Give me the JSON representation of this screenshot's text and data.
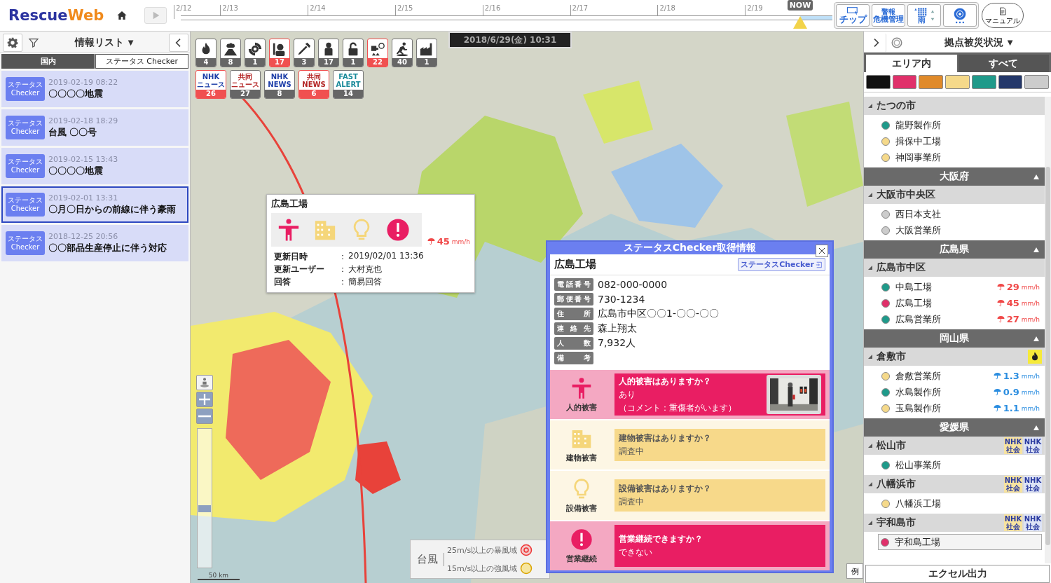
{
  "header": {
    "logo": {
      "main": "Rescue",
      "accent": "Web"
    },
    "timeline": {
      "dates": [
        "2/12",
        "2/13",
        "2/14",
        "2/15",
        "2/16",
        "2/17",
        "2/18",
        "2/19"
      ],
      "now_label": "NOW"
    },
    "tools": [
      {
        "kind": "chip",
        "label": "チップ"
      },
      {
        "kind": "alert",
        "title": "警報",
        "label": "危機管理"
      },
      {
        "kind": "rain",
        "label": "雨"
      },
      {
        "kind": "typhoon"
      },
      {
        "kind": "manual",
        "label": "マニュアル"
      }
    ]
  },
  "info_list": {
    "title": "情報リスト",
    "title_caret": "▼",
    "tabs": [
      {
        "label": "国内",
        "selected": false
      },
      {
        "label": "ステータス Checker",
        "selected": true
      }
    ],
    "items": [
      {
        "badge": [
          "ステータス",
          "Checker"
        ],
        "date": "2019-02-19 08:22",
        "title": "〇〇〇〇地震",
        "selected": false
      },
      {
        "badge": [
          "ステータス",
          "Checker"
        ],
        "date": "2019-02-18 18:29",
        "title": "台風 〇〇号",
        "selected": false
      },
      {
        "badge": [
          "ステータス",
          "Checker"
        ],
        "date": "2019-02-15 13:43",
        "title": "〇〇〇〇地震",
        "selected": false
      },
      {
        "badge": [
          "ステータス",
          "Checker"
        ],
        "date": "2019-02-01 13:31",
        "title": "〇月〇日からの前線に伴う豪雨",
        "selected": true
      },
      {
        "badge": [
          "ステータス",
          "Checker"
        ],
        "date": "2018-12-25 20:56",
        "title": "〇〇部品生産停止に伴う対応",
        "selected": false
      }
    ]
  },
  "map": {
    "date_box": "2018/6/29(金) 10:31",
    "categories": [
      {
        "kind": "fire",
        "count": "4",
        "alert": false
      },
      {
        "kind": "volcano",
        "count": "8",
        "alert": false
      },
      {
        "kind": "typhoon",
        "count": "1",
        "alert": false
      },
      {
        "kind": "worker",
        "count": "17",
        "alert": true
      },
      {
        "kind": "tool",
        "count": "3",
        "alert": false
      },
      {
        "kind": "person",
        "count": "17",
        "alert": false
      },
      {
        "kind": "lock",
        "count": "1",
        "alert": false
      },
      {
        "kind": "facility",
        "count": "22",
        "alert": true
      },
      {
        "kind": "runner",
        "count": "40",
        "alert": false
      },
      {
        "kind": "factory",
        "count": "1",
        "alert": false
      }
    ],
    "news": [
      {
        "lines": [
          "NHK",
          "ニュース"
        ],
        "color": "#1d3ea8",
        "count": "26",
        "alert": true
      },
      {
        "lines": [
          "共同",
          "ニュース"
        ],
        "color": "#b32424",
        "count": "27",
        "alert": false
      },
      {
        "lines": [
          "NHK",
          "NEWS"
        ],
        "color": "#1d3ea8",
        "count": "8",
        "alert": false
      },
      {
        "lines": [
          "共同",
          "NEWS"
        ],
        "color": "#b32424",
        "count": "6",
        "alert": true
      },
      {
        "lines": [
          "FAST",
          "ALERT"
        ],
        "color": "#1a8a9a",
        "count": "14",
        "alert": false
      }
    ],
    "zoom": {
      "level": 0.45
    },
    "scale": "50 km",
    "legend": {
      "title": "台風",
      "items": [
        {
          "kind": "storm",
          "label": "25m/s以上の暴風域"
        },
        {
          "kind": "strong",
          "label": "15m/s以上の強風域"
        }
      ]
    },
    "legend_button": "例",
    "popup": {
      "title": "広島工場",
      "statuses": [
        {
          "kind": "person",
          "severe": true
        },
        {
          "kind": "building",
          "severe": false
        },
        {
          "kind": "equipment",
          "severe": false
        },
        {
          "kind": "business",
          "severe": true
        }
      ],
      "rain": {
        "value": "45",
        "unit": "mm/h",
        "heavy": true
      },
      "separator": "：",
      "rows": [
        {
          "label": "更新日時",
          "value": "2019/02/01 13:36"
        },
        {
          "label": "更新ユーザー",
          "value": "大村克也"
        },
        {
          "label": "回答",
          "value": "簡易回答"
        }
      ]
    },
    "status_panel": {
      "title": "ステータスChecker取得情報",
      "site": "広島工場",
      "link": "ステータスChecker",
      "fields": [
        {
          "label": "電話番号",
          "value": "082-000-0000"
        },
        {
          "label": "郵便番号",
          "value": "730-1234"
        },
        {
          "label": "住所",
          "value": "広島市中区〇〇1-〇〇-〇〇"
        },
        {
          "label": "連絡先",
          "value": "森上翔太"
        },
        {
          "label": "人数",
          "value": "7,932人"
        },
        {
          "label": "備考"
        }
      ],
      "questions": [
        {
          "kind": "person",
          "severe": true,
          "category": "人的被害",
          "question": "人的被害はありますか？",
          "answer": "あり",
          "comment": "（コメント：重傷者がいます）"
        },
        {
          "kind": "building",
          "severe": false,
          "category": "建物被害",
          "question": "建物被害はありますか？",
          "answer": "調査中"
        },
        {
          "kind": "equipment",
          "severe": false,
          "category": "設備被害",
          "question": "設備被害はありますか？",
          "answer": "調査中"
        },
        {
          "kind": "business",
          "severe": true,
          "category": "営業継続",
          "question": "営業継続できますか？",
          "answer": "できない"
        }
      ]
    }
  },
  "site_panel": {
    "title": "拠点被災状況",
    "title_caret": "▼",
    "tabs": [
      {
        "label": "エリア内",
        "selected": true
      },
      {
        "label": "すべて",
        "selected": false
      }
    ],
    "filters": [
      {
        "color": "#111111"
      },
      {
        "color": "#e0306a"
      },
      {
        "color": "#e08a2a"
      },
      {
        "color": "#f5d98a"
      },
      {
        "color": "#1f9a8a"
      },
      {
        "color": "#24386a"
      },
      {
        "color": "#cccccc"
      }
    ],
    "tree": [
      {
        "kind": "city",
        "name": "たつの市",
        "expanded": true,
        "children": [
          {
            "name": "龍野製作所",
            "color": "#1f9a8a",
            "selected": false
          },
          {
            "name": "揖保中工場",
            "color": "#f5d98a",
            "selected": false
          },
          {
            "name": "神岡事業所",
            "color": "#f5d98a",
            "selected": false
          }
        ]
      },
      {
        "kind": "prefecture",
        "name": "大阪府",
        "expanded": true,
        "children": [
          {
            "kind": "city",
            "name": "大阪市中央区",
            "expanded": true,
            "children": [
              {
                "name": "西日本支社",
                "color": "#cccccc",
                "selected": false
              },
              {
                "name": "大阪営業所",
                "color": "#cccccc",
                "selected": false
              }
            ]
          }
        ]
      },
      {
        "kind": "prefecture",
        "name": "広島県",
        "expanded": true,
        "children": [
          {
            "kind": "city",
            "name": "広島市中区",
            "expanded": true,
            "children": [
              {
                "name": "中島工場",
                "color": "#1f9a8a",
                "selected": false,
                "rain": {
                  "value": "29",
                  "unit": "mm/h",
                  "heavy": true
                }
              },
              {
                "name": "広島工場",
                "color": "#e0306a",
                "selected": false,
                "rain": {
                  "value": "45",
                  "unit": "mm/h",
                  "heavy": true
                }
              },
              {
                "name": "広島営業所",
                "color": "#1f9a8a",
                "selected": false,
                "rain": {
                  "value": "27",
                  "unit": "mm/h",
                  "heavy": true
                }
              }
            ]
          }
        ]
      },
      {
        "kind": "prefecture",
        "name": "岡山県",
        "expanded": true,
        "children": [
          {
            "kind": "city",
            "name": "倉敷市",
            "expanded": true,
            "badges": [
              {
                "kind": "fire"
              }
            ],
            "children": [
              {
                "name": "倉敷営業所",
                "color": "#f5d98a",
                "selected": false,
                "rain": {
                  "value": "1.3",
                  "unit": "mm/h",
                  "heavy": false
                }
              },
              {
                "name": "水島製作所",
                "color": "#1f9a8a",
                "selected": false,
                "rain": {
                  "value": "0.9",
                  "unit": "mm/h",
                  "heavy": false
                }
              },
              {
                "name": "玉島製作所",
                "color": "#f5d98a",
                "selected": false,
                "rain": {
                  "value": "1.1",
                  "unit": "mm/h",
                  "heavy": false
                }
              }
            ]
          }
        ]
      },
      {
        "kind": "prefecture",
        "name": "愛媛県",
        "expanded": true,
        "children": [
          {
            "kind": "city",
            "name": "松山市",
            "expanded": true,
            "badges": [
              {
                "kind": "news",
                "lines": [
                  "NHK",
                  "社会"
                ],
                "color": "#f7e3a0"
              },
              {
                "kind": "news",
                "lines": [
                  "NHK",
                  "社会"
                ],
                "color": "#dde3f5"
              }
            ],
            "children": [
              {
                "name": "松山事業所",
                "color": "#1f9a8a",
                "selected": false
              }
            ]
          },
          {
            "kind": "city",
            "name": "八幡浜市",
            "expanded": true,
            "badges": [
              {
                "kind": "news",
                "lines": [
                  "NHK",
                  "社会"
                ],
                "color": "#f7e3a0"
              },
              {
                "kind": "news",
                "lines": [
                  "NHK",
                  "社会"
                ],
                "color": "#dde3f5"
              }
            ],
            "children": [
              {
                "name": "八幡浜工場",
                "color": "#f5d98a",
                "selected": false
              }
            ]
          },
          {
            "kind": "city",
            "name": "宇和島市",
            "expanded": true,
            "badges": [
              {
                "kind": "news",
                "lines": [
                  "NHK",
                  "社会"
                ],
                "color": "#f7e3a0"
              },
              {
                "kind": "news",
                "lines": [
                  "NHK",
                  "社会"
                ],
                "color": "#dde3f5"
              }
            ],
            "children": [
              {
                "name": "宇和島工場",
                "color": "#e0306a",
                "selected": true
              }
            ]
          }
        ]
      }
    ],
    "export_button": "エクセル出力"
  }
}
